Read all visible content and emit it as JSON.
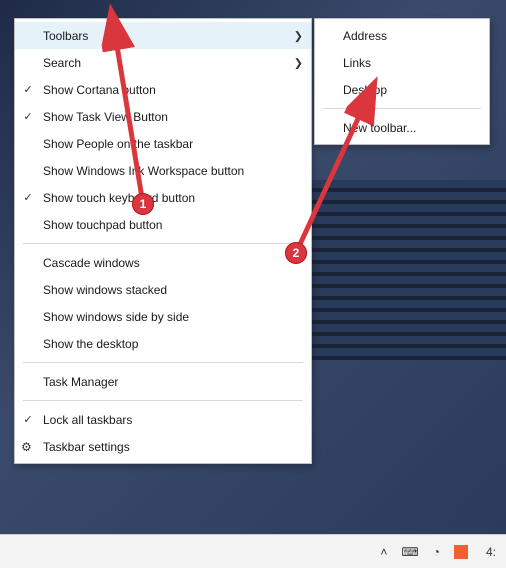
{
  "menu_main": {
    "items": [
      {
        "label": "Toolbars",
        "has_submenu": true,
        "hovered": true
      },
      {
        "label": "Search",
        "has_submenu": true
      },
      {
        "label": "Show Cortana button",
        "checked": true
      },
      {
        "label": "Show Task View Button",
        "checked": true
      },
      {
        "label": "Show People on the taskbar"
      },
      {
        "label": "Show Windows Ink Workspace button"
      },
      {
        "label": "Show touch keyboard button",
        "checked": true
      },
      {
        "label": "Show touchpad button"
      },
      {
        "sep": true
      },
      {
        "label": "Cascade windows"
      },
      {
        "label": "Show windows stacked"
      },
      {
        "label": "Show windows side by side"
      },
      {
        "label": "Show the desktop"
      },
      {
        "sep": true
      },
      {
        "label": "Task Manager"
      },
      {
        "sep": true
      },
      {
        "label": "Lock all taskbars",
        "checked": true
      },
      {
        "label": "Taskbar settings",
        "icon": "gear"
      }
    ]
  },
  "menu_sub": {
    "items": [
      {
        "label": "Address"
      },
      {
        "label": "Links"
      },
      {
        "label": "Desktop"
      },
      {
        "sep": true
      },
      {
        "label": "New toolbar..."
      }
    ]
  },
  "annotations": {
    "badge1": "1",
    "badge2": "2"
  },
  "taskbar": {
    "clock": "4:"
  },
  "colors": {
    "annotation_red": "#d9363e"
  }
}
